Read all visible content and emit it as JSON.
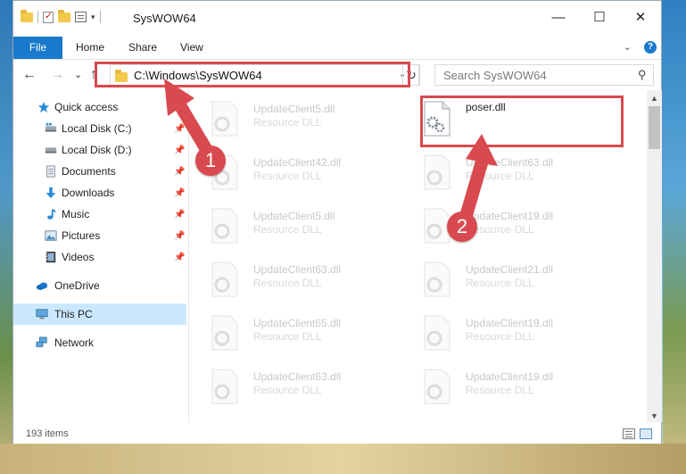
{
  "window": {
    "title": "SysWOW64",
    "minimize_glyph": "—",
    "maximize_glyph": "☐",
    "close_glyph": "✕"
  },
  "ribbon": {
    "tabs": [
      "File",
      "Home",
      "Share",
      "View"
    ],
    "help_glyph": "?"
  },
  "nav": {
    "back_glyph": "←",
    "forward_glyph": "→",
    "recent_glyph": "⌄",
    "up_glyph": "↑",
    "address": "C:\\Windows\\SysWOW64",
    "refresh_glyph": "↻",
    "search_placeholder": "Search SysWOW64"
  },
  "sidebar": {
    "items": [
      {
        "label": "Quick access",
        "icon": "star-icon",
        "pinned": false
      },
      {
        "label": "Local Disk (C:)",
        "icon": "drive-icon",
        "pinned": true
      },
      {
        "label": "Local Disk (D:)",
        "icon": "drive-icon",
        "pinned": true
      },
      {
        "label": "Documents",
        "icon": "documents-icon",
        "pinned": true
      },
      {
        "label": "Downloads",
        "icon": "download-icon",
        "pinned": true
      },
      {
        "label": "Music",
        "icon": "music-icon",
        "pinned": true
      },
      {
        "label": "Pictures",
        "icon": "pictures-icon",
        "pinned": true
      },
      {
        "label": "Videos",
        "icon": "videos-icon",
        "pinned": true
      },
      {
        "label": "OneDrive",
        "icon": "cloud-icon",
        "pinned": false
      },
      {
        "label": "This PC",
        "icon": "computer-icon",
        "pinned": false,
        "selected": true
      },
      {
        "label": "Network",
        "icon": "network-icon",
        "pinned": false
      }
    ]
  },
  "files": {
    "left": [
      {
        "name": "UpdateClient5.dll",
        "type": "Resource DLL"
      },
      {
        "name": "UpdateClient42.dll",
        "type": "Resource DLL"
      },
      {
        "name": "UpdateClient5.dll",
        "type": "Resource DLL"
      },
      {
        "name": "UpdateClient63.dll",
        "type": "Resource DLL"
      },
      {
        "name": "UpdateClient65.dll",
        "type": "Resource DLL"
      },
      {
        "name": "UpdateClient63.dll",
        "type": "Resource DLL"
      }
    ],
    "right": [
      {
        "name": "poser.dll",
        "type": "",
        "highlighted": true
      },
      {
        "name": "UpdateClient63.dll",
        "type": "Resource DLL"
      },
      {
        "name": "UpdateClient19.dll",
        "type": "Resource DLL"
      },
      {
        "name": "UpdateClient21.dll",
        "type": "Resource DLL"
      },
      {
        "name": "UpdateClient19.dll",
        "type": "Resource DLL"
      },
      {
        "name": "UpdateClient19.dll",
        "type": "Resource DLL"
      }
    ]
  },
  "status": {
    "item_count": "193 items"
  },
  "annotations": {
    "step1": "1",
    "step2": "2",
    "color": "#d84a4f"
  }
}
